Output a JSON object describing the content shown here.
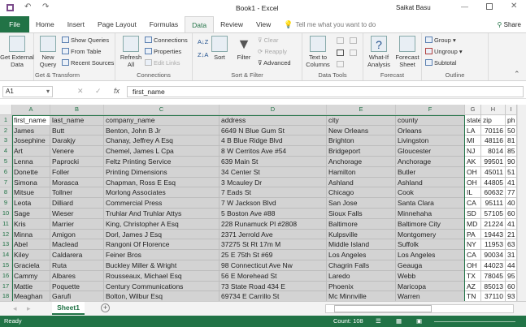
{
  "titlebar": {
    "title": "Book1 - Excel",
    "user": "Saikat Basu",
    "icons": [
      "save-icon",
      "undo-icon",
      "redo-icon",
      "touch-mode-icon",
      "customize-icon"
    ]
  },
  "tabs": [
    "File",
    "Home",
    "Insert",
    "Page Layout",
    "Formulas",
    "Data",
    "Review",
    "View"
  ],
  "active_tab": "Data",
  "tell_me": "Tell me what you want to do",
  "share": "Share",
  "ribbon": {
    "get_transform": {
      "label": "Get & Transform",
      "get_external": "Get External Data",
      "new_query": "New Query",
      "show_queries": "Show Queries",
      "from_table": "From Table",
      "recent_sources": "Recent Sources"
    },
    "connections": {
      "label": "Connections",
      "refresh": "Refresh All",
      "connections": "Connections",
      "properties": "Properties",
      "edit_links": "Edit Links"
    },
    "sort_filter": {
      "label": "Sort & Filter",
      "sort": "Sort",
      "filter": "Filter",
      "clear": "Clear",
      "reapply": "Reapply",
      "advanced": "Advanced"
    },
    "data_tools": {
      "label": "Data Tools",
      "text_to_columns": "Text to Columns"
    },
    "forecast": {
      "label": "Forecast",
      "what_if": "What-If Analysis",
      "forecast_sheet": "Forecast Sheet"
    },
    "outline": {
      "label": "Outline",
      "group": "Group",
      "ungroup": "Ungroup",
      "subtotal": "Subtotal"
    }
  },
  "formula_bar": {
    "name_box": "A1",
    "fx": "fx",
    "value": "first_name"
  },
  "columns": [
    "A",
    "B",
    "C",
    "D",
    "E",
    "F",
    "G",
    "H",
    "I"
  ],
  "rows": [
    [
      "first_name",
      "last_name",
      "company_name",
      "address",
      "city",
      "county",
      "state",
      "zip",
      "ph"
    ],
    [
      "James",
      "Butt",
      "Benton, John B Jr",
      "6649 N Blue Gum St",
      "New Orleans",
      "Orleans",
      "LA",
      "70116",
      "50"
    ],
    [
      "Josephine",
      "Darakjy",
      "Chanay, Jeffrey A Esq",
      "4 B Blue Ridge Blvd",
      "Brighton",
      "Livingston",
      "MI",
      "48116",
      "81"
    ],
    [
      "Art",
      "Venere",
      "Chemel, James L Cpa",
      "8 W Cerritos Ave #54",
      "Bridgeport",
      "Gloucester",
      "NJ",
      "8014",
      "85"
    ],
    [
      "Lenna",
      "Paprocki",
      "Feltz Printing Service",
      "639 Main St",
      "Anchorage",
      "Anchorage",
      "AK",
      "99501",
      "90"
    ],
    [
      "Donette",
      "Foller",
      "Printing Dimensions",
      "34 Center St",
      "Hamilton",
      "Butler",
      "OH",
      "45011",
      "51"
    ],
    [
      "Simona",
      "Morasca",
      "Chapman, Ross E Esq",
      "3 Mcauley Dr",
      "Ashland",
      "Ashland",
      "OH",
      "44805",
      "41"
    ],
    [
      "Mitsue",
      "Tollner",
      "Morlong Associates",
      "7 Eads St",
      "Chicago",
      "Cook",
      "IL",
      "60632",
      "77"
    ],
    [
      "Leota",
      "Dilliard",
      "Commercial Press",
      "7 W Jackson Blvd",
      "San Jose",
      "Santa Clara",
      "CA",
      "95111",
      "40"
    ],
    [
      "Sage",
      "Wieser",
      "Truhlar And Truhlar Attys",
      "5 Boston Ave #88",
      "Sioux Falls",
      "Minnehaha",
      "SD",
      "57105",
      "60"
    ],
    [
      "Kris",
      "Marrier",
      "King, Christopher A Esq",
      "228 Runamuck Pl #2808",
      "Baltimore",
      "Baltimore City",
      "MD",
      "21224",
      "41"
    ],
    [
      "Minna",
      "Amigon",
      "Dorl, James J Esq",
      "2371 Jerrold Ave",
      "Kulpsville",
      "Montgomery",
      "PA",
      "19443",
      "21"
    ],
    [
      "Abel",
      "Maclead",
      "Rangoni Of Florence",
      "37275 St  Rt 17m M",
      "Middle Island",
      "Suffolk",
      "NY",
      "11953",
      "63"
    ],
    [
      "Kiley",
      "Caldarera",
      "Feiner Bros",
      "25 E 75th St #69",
      "Los Angeles",
      "Los Angeles",
      "CA",
      "90034",
      "31"
    ],
    [
      "Graciela",
      "Ruta",
      "Buckley Miller & Wright",
      "98 Connecticut Ave Nw",
      "Chagrin Falls",
      "Geauga",
      "OH",
      "44023",
      "44"
    ],
    [
      "Cammy",
      "Albares",
      "Rousseaux, Michael Esq",
      "56 E Morehead St",
      "Laredo",
      "Webb",
      "TX",
      "78045",
      "95"
    ],
    [
      "Mattie",
      "Poquette",
      "Century Communications",
      "73 State Road 434 E",
      "Phoenix",
      "Maricopa",
      "AZ",
      "85013",
      "60"
    ],
    [
      "Meaghan",
      "Garufi",
      "Bolton, Wilbur Esq",
      "69734 E Carrillo St",
      "Mc Minnville",
      "Warren",
      "TN",
      "37110",
      "93"
    ]
  ],
  "sheet_tab": "Sheet1",
  "status": {
    "ready": "Ready",
    "count": "Count: 108"
  },
  "colors": {
    "accent": "#217346",
    "selection": "#d3d3d3"
  }
}
